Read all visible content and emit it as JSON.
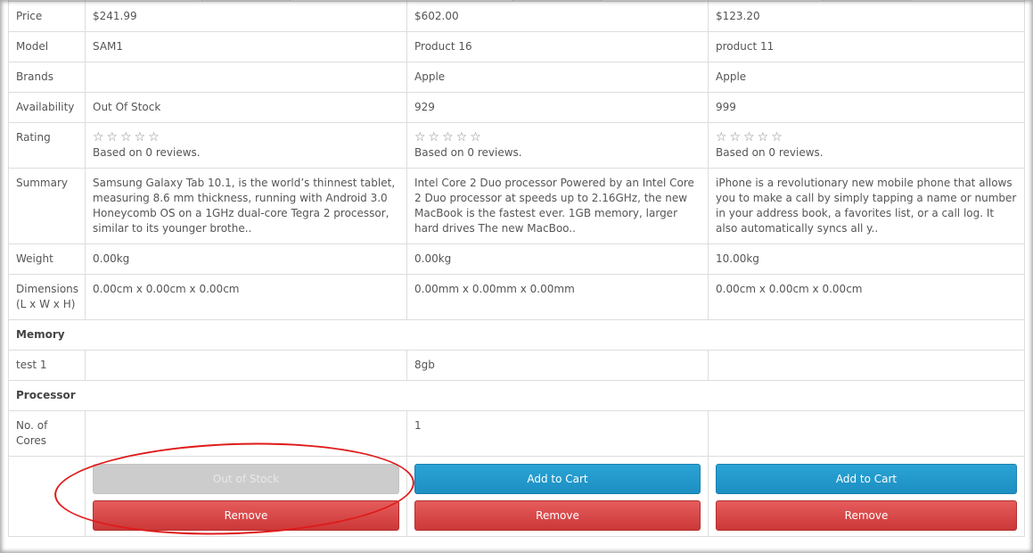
{
  "rows": {
    "price": {
      "label": "Price",
      "values": [
        "$241.99",
        "$602.00",
        "$123.20"
      ]
    },
    "model": {
      "label": "Model",
      "values": [
        "SAM1",
        "Product 16",
        "product 11"
      ]
    },
    "brands": {
      "label": "Brands",
      "values": [
        "",
        "Apple",
        "Apple"
      ]
    },
    "availability": {
      "label": "Availability",
      "values": [
        "Out Of Stock",
        "929",
        "999"
      ]
    },
    "rating": {
      "label": "Rating",
      "stars": "☆☆☆☆☆",
      "reviews": [
        "Based on 0 reviews.",
        "Based on 0 reviews.",
        "Based on 0 reviews."
      ]
    },
    "summary": {
      "label": "Summary",
      "values": [
        "Samsung Galaxy Tab 10.1, is the world’s thinnest tablet, measuring 8.6 mm thickness, running with Android 3.0 Honeycomb OS on a 1GHz dual-core Tegra 2 processor, similar to its younger brothe..",
        "Intel Core 2 Duo processor Powered by an Intel Core 2 Duo processor at speeds up to 2.16GHz, the new MacBook is the fastest ever. 1GB memory, larger hard drives The new MacBoo..",
        "iPhone is a revolutionary new mobile phone that allows you to make a call by simply tapping a name or number in your address book, a favorites list, or a call log. It also automatically syncs all y.."
      ]
    },
    "weight": {
      "label": "Weight",
      "values": [
        "0.00kg",
        "0.00kg",
        "10.00kg"
      ]
    },
    "dimensions": {
      "label": "Dimensions (L x W x H)",
      "values": [
        "0.00cm x 0.00cm x 0.00cm",
        "0.00mm x 0.00mm x 0.00mm",
        "0.00cm x 0.00cm x 0.00cm"
      ]
    }
  },
  "groups": {
    "memory": {
      "label": "Memory",
      "test1": {
        "label": "test 1",
        "values": [
          "",
          "8gb",
          ""
        ]
      }
    },
    "processor": {
      "label": "Processor",
      "cores": {
        "label": "No. of Cores",
        "values": [
          "",
          "1",
          ""
        ]
      }
    }
  },
  "actions": {
    "out_of_stock_label": "Out of Stock",
    "add_to_cart_label": "Add to Cart",
    "remove_label": "Remove"
  },
  "colors": {
    "annotation": "#e01a1a",
    "cart_button": "#1d8fc2",
    "remove_button": "#cc3838"
  }
}
